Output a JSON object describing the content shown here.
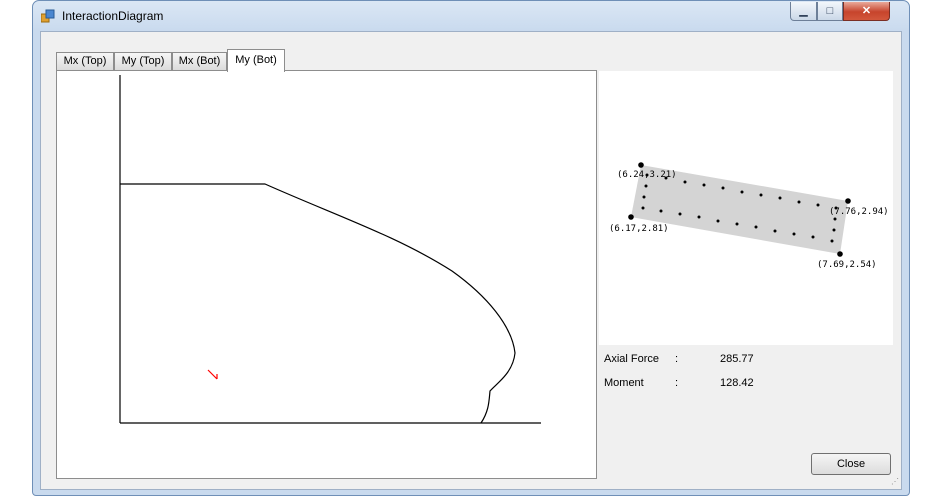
{
  "window": {
    "title": "InteractionDiagram",
    "controls": {
      "minimize": "▁",
      "maximize": "□",
      "close": "✕"
    }
  },
  "tabs": [
    {
      "label": "Mx (Top)",
      "active": false
    },
    {
      "label": "My (Top)",
      "active": false
    },
    {
      "label": "Mx (Bot)",
      "active": false
    },
    {
      "label": "My (Bot)",
      "active": true
    }
  ],
  "preview": {
    "corners": [
      {
        "label": "(6.24,3.21)"
      },
      {
        "label": "(7.76,2.94)"
      },
      {
        "label": "(6.17,2.81)"
      },
      {
        "label": "(7.69,2.54)"
      }
    ]
  },
  "info": {
    "axial_force": {
      "label": "Axial Force",
      "sep": ":",
      "value": "285.77"
    },
    "moment": {
      "label": "Moment",
      "sep": ":",
      "value": "128.42"
    }
  },
  "buttons": {
    "close_label": "Close"
  },
  "colors": {
    "curve": "#000000",
    "point_marker": "#ff0000",
    "section_fill": "#d4d4d4"
  }
}
